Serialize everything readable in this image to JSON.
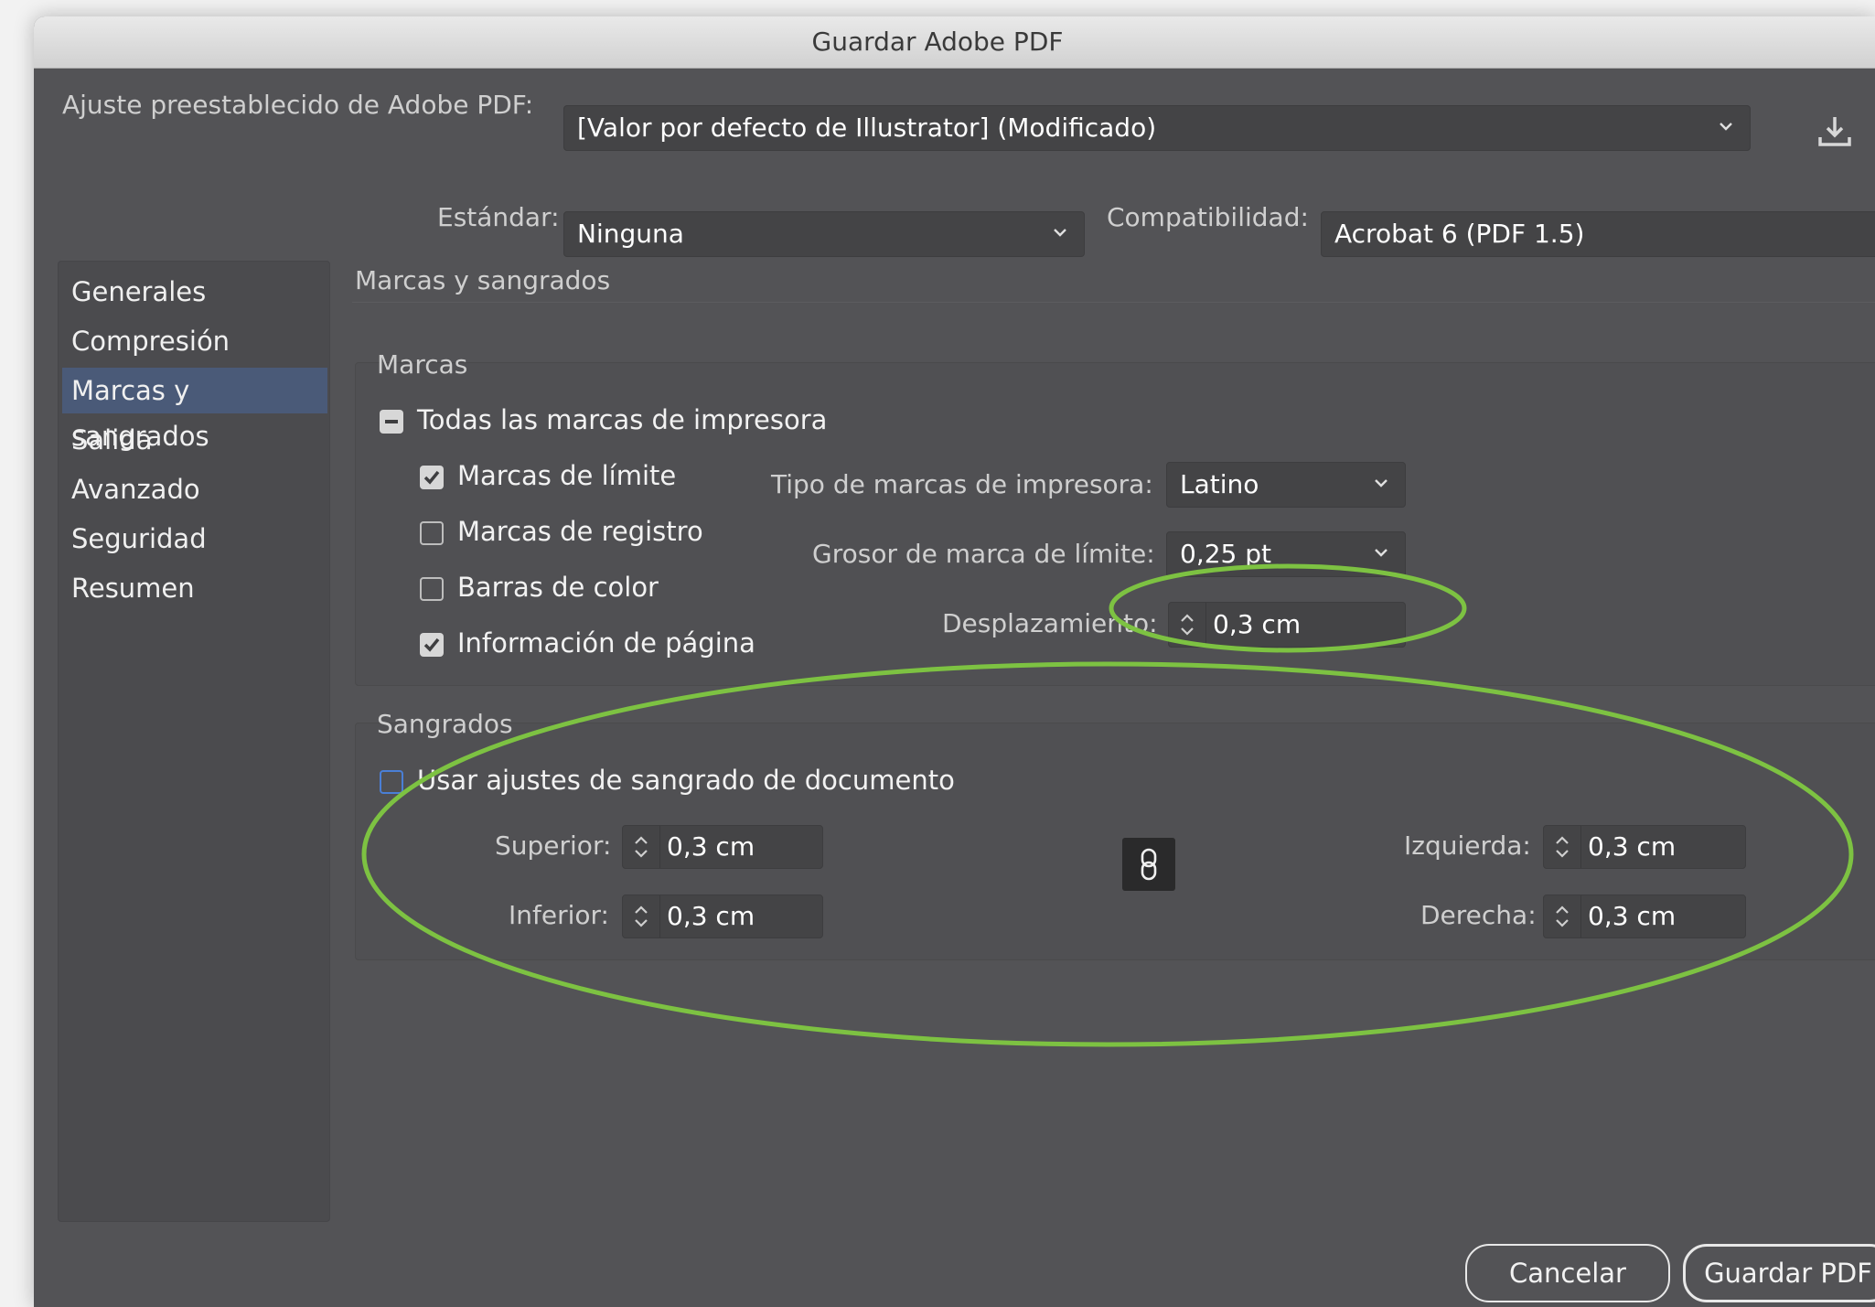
{
  "window": {
    "title": "Guardar Adobe PDF"
  },
  "preset": {
    "label": "Ajuste preestablecido de Adobe PDF:",
    "value": "[Valor por defecto de Illustrator] (Modificado)"
  },
  "standard": {
    "label": "Estándar:",
    "value": "Ninguna"
  },
  "compat": {
    "label": "Compatibilidad:",
    "value": "Acrobat 6 (PDF 1.5)"
  },
  "sidebar": {
    "items": [
      {
        "label": "Generales"
      },
      {
        "label": "Compresión"
      },
      {
        "label": "Marcas y sangrados"
      },
      {
        "label": "Salida"
      },
      {
        "label": "Avanzado"
      },
      {
        "label": "Seguridad"
      },
      {
        "label": "Resumen"
      }
    ],
    "active": "Marcas y sangrados"
  },
  "panel": {
    "title": "Marcas y sangrados"
  },
  "marks": {
    "section_label": "Marcas",
    "all_printer_marks": "Todas las marcas de impresora",
    "trim_marks": "Marcas de límite",
    "registration_marks": "Marcas de registro",
    "color_bars": "Barras de color",
    "page_info": "Información de página",
    "type_label": "Tipo de marcas de impresora:",
    "type_value": "Latino",
    "weight_label": "Grosor de marca de límite:",
    "weight_value": "0,25 pt",
    "offset_label": "Desplazamiento:",
    "offset_value": "0,3 cm"
  },
  "bleeds": {
    "section_label": "Sangrados",
    "use_doc_bleed": "Usar ajustes de sangrado de documento",
    "top_label": "Superior:",
    "top_value": "0,3 cm",
    "bottom_label": "Inferior:",
    "bottom_value": "0,3 cm",
    "left_label": "Izquierda:",
    "left_value": "0,3 cm",
    "right_label": "Derecha:",
    "right_value": "0,3 cm"
  },
  "buttons": {
    "cancel": "Cancelar",
    "save": "Guardar PDF"
  },
  "colors": {
    "panel_bg": "#535356",
    "selected_item": "#4a5a78",
    "annotation": "#7dc242"
  }
}
